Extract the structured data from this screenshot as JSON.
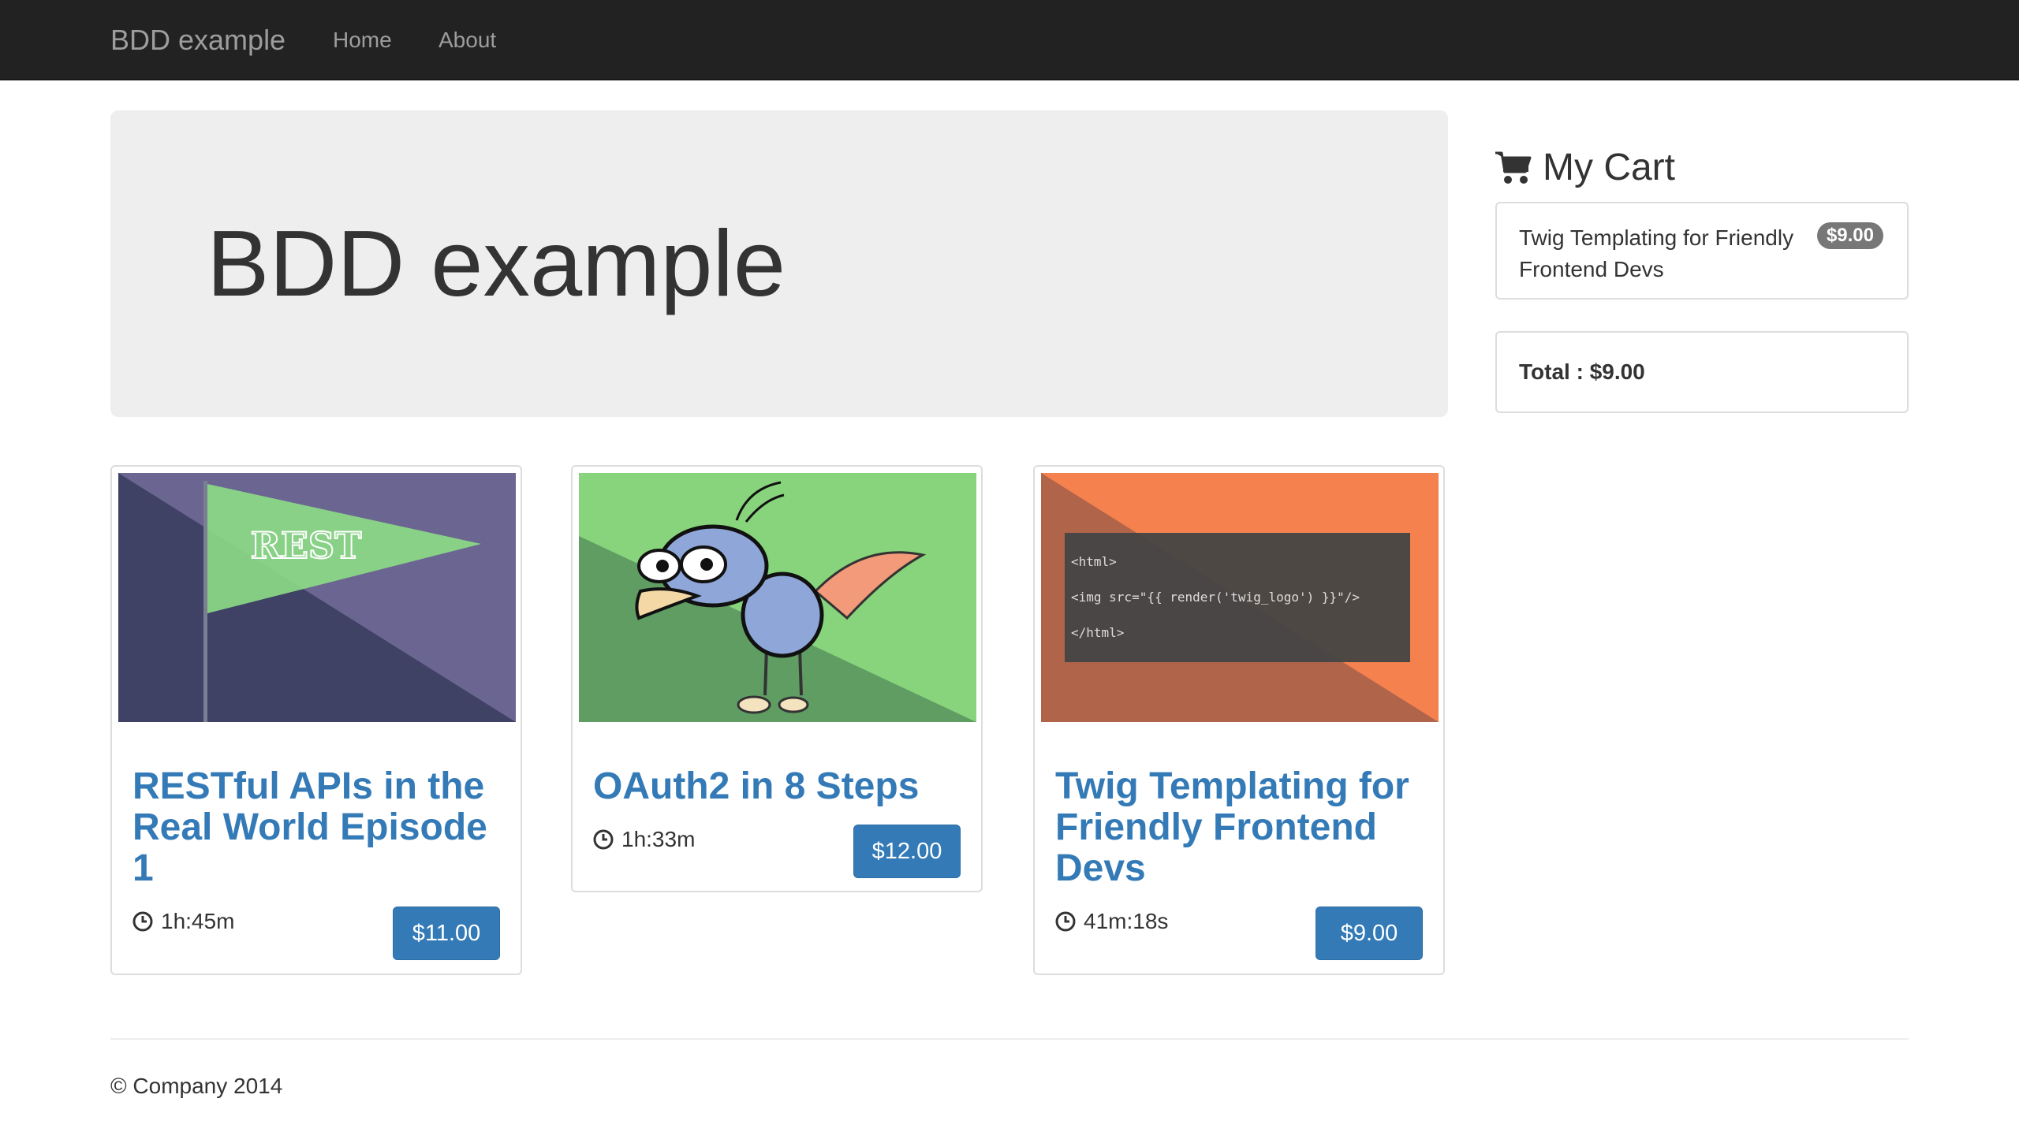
{
  "navbar": {
    "brand": "BDD example",
    "links": [
      "Home",
      "About"
    ]
  },
  "jumbotron": {
    "title": "BDD example"
  },
  "products": [
    {
      "title": "RESTful APIs in the Real World Episode 1",
      "duration": "1h:45m",
      "price": "$11.00",
      "thumb_text": "REST",
      "thumb_colors": [
        "#6b6691",
        "#3f4265",
        "#8ddd86"
      ]
    },
    {
      "title": "OAuth2 in 8 Steps",
      "duration": "1h:33m",
      "price": "$12.00",
      "thumb_colors": [
        "#88d47c",
        "#5f9d63"
      ]
    },
    {
      "title": "Twig Templating for Friendly Frontend Devs",
      "duration": "41m:18s",
      "price": "$9.00",
      "thumb_code": [
        "<html>",
        "<img src=\"{{ render('twig_logo') }}\"/>",
        "</html>"
      ],
      "thumb_colors": [
        "#f5814f",
        "#b0644a",
        "#444444"
      ]
    }
  ],
  "cart": {
    "title": "My Cart",
    "items": [
      {
        "name": "Twig Templating for Friendly Frontend Devs",
        "price": "$9.00"
      }
    ],
    "total": "Total : $9.00"
  },
  "footer": {
    "text": "© Company 2014"
  },
  "colors": {
    "navbar_bg": "#222222",
    "link_blue": "#337ab7",
    "jumbotron_bg": "#eeeeee",
    "badge_gray": "#777777"
  }
}
